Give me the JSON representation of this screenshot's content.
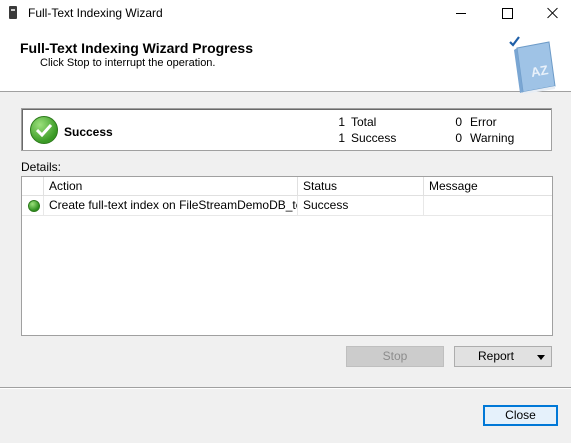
{
  "window": {
    "title": "Full-Text Indexing Wizard"
  },
  "header": {
    "title": "Full-Text Indexing Wizard Progress",
    "subtitle": "Click Stop to interrupt the operation.",
    "book_label": "AZ"
  },
  "summary": {
    "status": "Success",
    "total_count": "1",
    "total_label": "Total",
    "success_count": "1",
    "success_label": "Success",
    "error_count": "0",
    "error_label": "Error",
    "warning_count": "0",
    "warning_label": "Warning"
  },
  "details": {
    "label": "Details:",
    "columns": {
      "action": "Action",
      "status": "Status",
      "message": "Message"
    },
    "rows": [
      {
        "action": "Create full-text index on FileStreamDemoDB_test...",
        "status": "Success",
        "message": ""
      }
    ]
  },
  "buttons": {
    "stop": "Stop",
    "report": "Report",
    "close": "Close"
  },
  "colors": {
    "accent": "#0078d7",
    "success": "#3a9a25"
  }
}
